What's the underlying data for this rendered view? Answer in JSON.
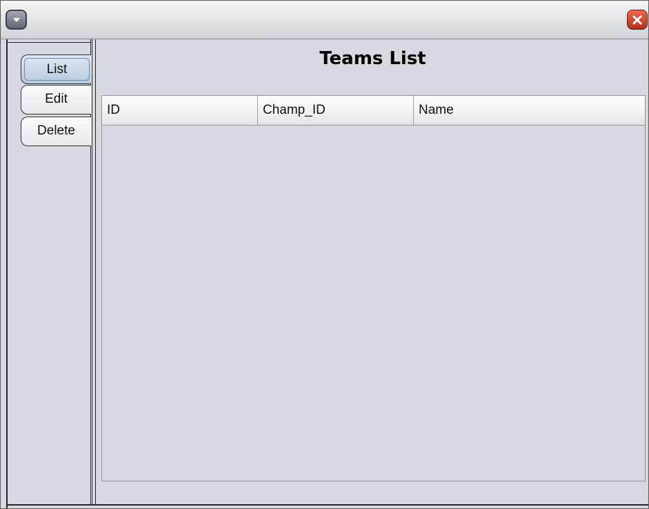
{
  "window": {
    "menu_icon": "chevron-down-icon",
    "close_icon": "close-icon",
    "close_color": "#c0392b"
  },
  "tabs": [
    {
      "label": "List",
      "selected": true
    },
    {
      "label": "Edit",
      "selected": false
    },
    {
      "label": "Delete",
      "selected": false
    }
  ],
  "panel": {
    "title": "Teams List"
  },
  "table": {
    "columns": [
      "ID",
      "Champ_ID",
      "Name"
    ],
    "rows": []
  }
}
